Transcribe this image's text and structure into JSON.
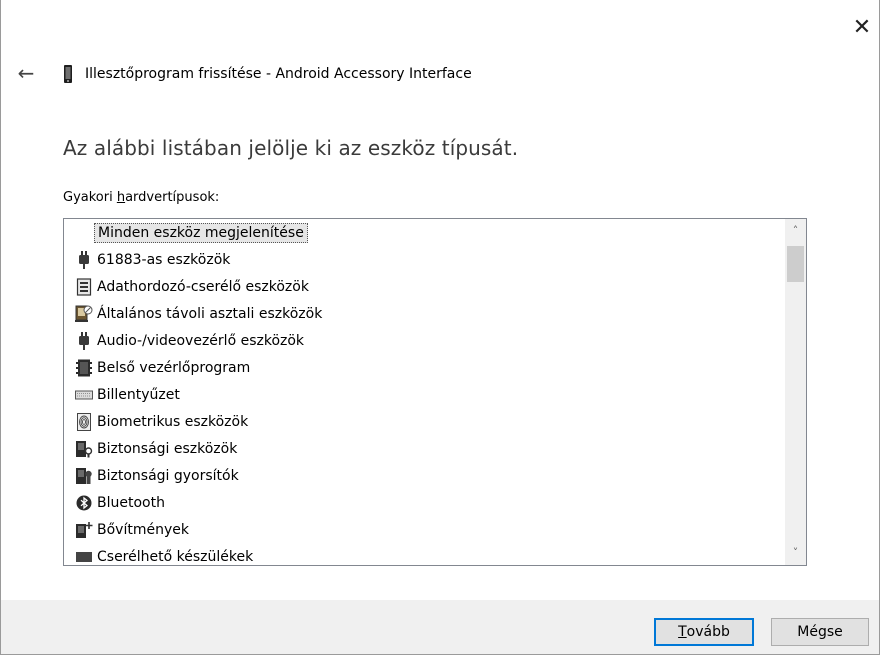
{
  "window": {
    "close_label": "✕",
    "back_label": "←",
    "title": "Illesztőprogram frissítése - Android Accessory Interface"
  },
  "instruction": "Az alábbi listában jelölje ki az eszköz típusát.",
  "group_label": {
    "prefix": "Gyakori ",
    "accel": "h",
    "suffix": "ardvertípusok:"
  },
  "list": {
    "header_item": "Minden eszköz megjelenítése",
    "items": [
      {
        "label": "61883-as eszközök",
        "icon": "plug-icon"
      },
      {
        "label": "Adathordozó-cserélő eszközök",
        "icon": "media-changer-icon"
      },
      {
        "label": "Általános távoli asztali eszközök",
        "icon": "remote-desktop-icon"
      },
      {
        "label": "Audio-/videovezérlő eszközök",
        "icon": "plug-icon"
      },
      {
        "label": "Belső vezérlőprogram",
        "icon": "firmware-icon"
      },
      {
        "label": "Billentyűzet",
        "icon": "keyboard-icon"
      },
      {
        "label": "Biometrikus eszközök",
        "icon": "fingerprint-icon"
      },
      {
        "label": "Biztonsági eszközök",
        "icon": "security-device-icon"
      },
      {
        "label": "Biztonsági gyorsítók",
        "icon": "security-accelerator-icon"
      },
      {
        "label": "Bluetooth",
        "icon": "bluetooth-icon"
      },
      {
        "label": "Bővítmények",
        "icon": "extensions-icon"
      },
      {
        "label": "Cserélhető készülékek",
        "icon": "removable-icon"
      }
    ]
  },
  "buttons": {
    "next": {
      "accel": "T",
      "rest": "ovább"
    },
    "cancel": "Mégse"
  }
}
